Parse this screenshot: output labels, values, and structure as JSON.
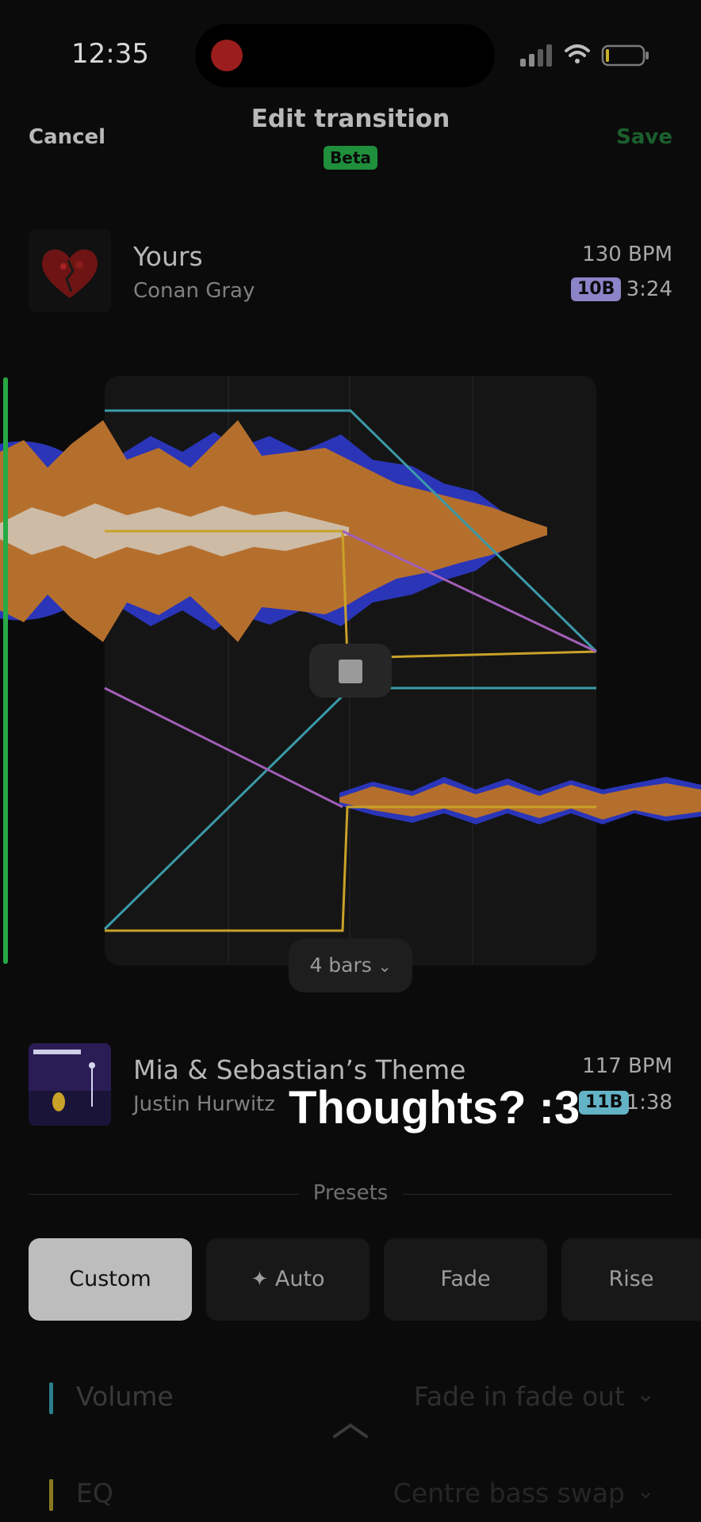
{
  "status_bar": {
    "time": "12:35"
  },
  "header": {
    "cancel": "Cancel",
    "title": "Edit transition",
    "badge": "Beta",
    "save": "Save"
  },
  "track_a": {
    "title": "Yours",
    "artist": "Conan Gray",
    "bpm": "130 BPM",
    "key": "10B",
    "duration": "3:24",
    "key_color": "#8c84c8"
  },
  "track_b": {
    "title": "Mia & Sebastian’s Theme",
    "artist": "Justin Hurwitz",
    "bpm": "117 BPM",
    "key": "11B",
    "duration": "1:38",
    "key_color": "#63b2c6"
  },
  "editor": {
    "length_label": "4 bars",
    "overlay_text": "Thoughts? :3"
  },
  "presets": {
    "label": "Presets",
    "items": [
      "Custom",
      "Auto",
      "Fade",
      "Rise"
    ],
    "active": "Custom"
  },
  "settings": [
    {
      "label": "Volume",
      "value": "Fade in fade out",
      "color": "#2b7f8b"
    },
    {
      "label": "EQ",
      "value": "Centre bass swap",
      "color": "#8a7a1e"
    }
  ],
  "colors": {
    "accent_green": "#27a944",
    "volume_line": "#3b9aa8",
    "eq_line": "#c9a228",
    "filter_line": "#a15fb8",
    "wave_orange": "#b56f2d",
    "wave_blue": "#2a35b8"
  }
}
